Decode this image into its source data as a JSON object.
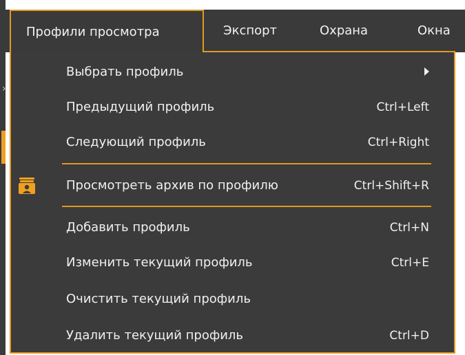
{
  "menubar": {
    "items": [
      {
        "label": "Профили просмотра",
        "active": true
      },
      {
        "label": "Экспорт",
        "active": false
      },
      {
        "label": "Охрана",
        "active": false
      },
      {
        "label": "Окна",
        "active": false
      }
    ]
  },
  "dropdown": {
    "items": [
      {
        "label": "Выбрать профиль",
        "shortcut": "",
        "submenu": true
      },
      {
        "label": "Предыдущий профиль",
        "shortcut": "Ctrl+Left"
      },
      {
        "label": "Следующий профиль",
        "shortcut": "Ctrl+Right"
      },
      {
        "label": "Просмотреть архив по профилю",
        "shortcut": "Ctrl+Shift+R",
        "icon": "archive-profile-icon"
      },
      {
        "label": "Добавить профиль",
        "shortcut": "Ctrl+N"
      },
      {
        "label": "Изменить текущий профиль",
        "shortcut": "Ctrl+E"
      },
      {
        "label": "Очистить текущий профиль",
        "shortcut": ""
      },
      {
        "label": "Удалить текущий профиль",
        "shortcut": "Ctrl+D"
      }
    ]
  },
  "colors": {
    "accent": "#e39a1f",
    "panel_bg": "#3b3b3b",
    "text": "#f0f0f0"
  },
  "icons": {
    "left_strip_chevron": "chevron-right-icon",
    "submenu_arrow": "submenu-arrow-icon"
  }
}
